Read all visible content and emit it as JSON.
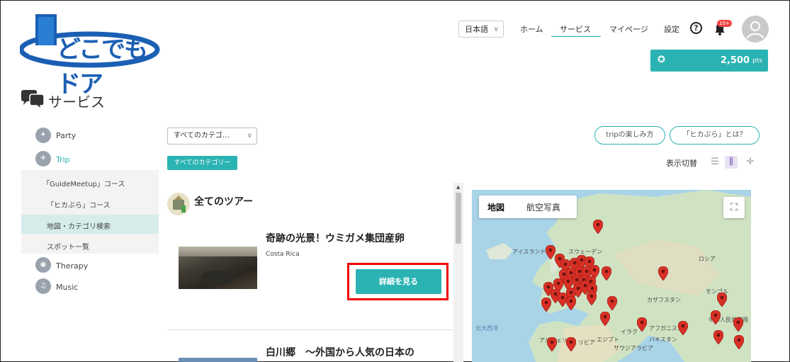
{
  "brand": {
    "name": "どこでもドア"
  },
  "header": {
    "language": "日本語",
    "nav": [
      "ホーム",
      "サービス",
      "マイページ",
      "設定"
    ],
    "notification_count": "10+",
    "points": {
      "value": "2,500",
      "unit": "pts"
    }
  },
  "page": {
    "title": "サービス"
  },
  "sidebar": {
    "items": [
      {
        "label": "Party",
        "icon": "party-icon"
      },
      {
        "label": "Trip",
        "icon": "trip-icon",
        "active": true
      },
      {
        "label": "Therapy",
        "icon": "therapy-icon"
      },
      {
        "label": "Music",
        "icon": "music-icon"
      }
    ],
    "trip_sub": [
      "「GuideMeetup」コース",
      "「ヒカぶら」コース",
      "地図・カテゴリ検索",
      "スポット一覧"
    ]
  },
  "filters": {
    "category_select": "すべてのカテゴ…",
    "category_tag": "すべてのカテゴリー",
    "pill_buttons": [
      "tripの楽しみ方",
      "「ヒカぶら」とは？"
    ],
    "view_label": "表示切替"
  },
  "tours": {
    "heading": "全てのツアー",
    "items": [
      {
        "title": "奇跡の光景！ウミガメ集団産卵",
        "location": "Costa Rica",
        "button": "詳細を見る"
      },
      {
        "title": "白川郷　～外国から人気の日本の"
      }
    ]
  },
  "map": {
    "tabs": [
      "地図",
      "航空写真"
    ],
    "labels": [
      "アイスランド",
      "スウェーデン",
      "ロシア",
      "カザフスタン",
      "モンゴル",
      "北大西洋",
      "イラク",
      "アフガニスタン",
      "パキスタン",
      "アルジェリア",
      "リビア",
      "エジプト",
      "サウジアラビア",
      "中華人民共和国"
    ]
  },
  "colors": {
    "accent": "#2bb3b3",
    "brand": "#1b5fb4",
    "highlight": "#e00000",
    "marker": "#d93025"
  }
}
